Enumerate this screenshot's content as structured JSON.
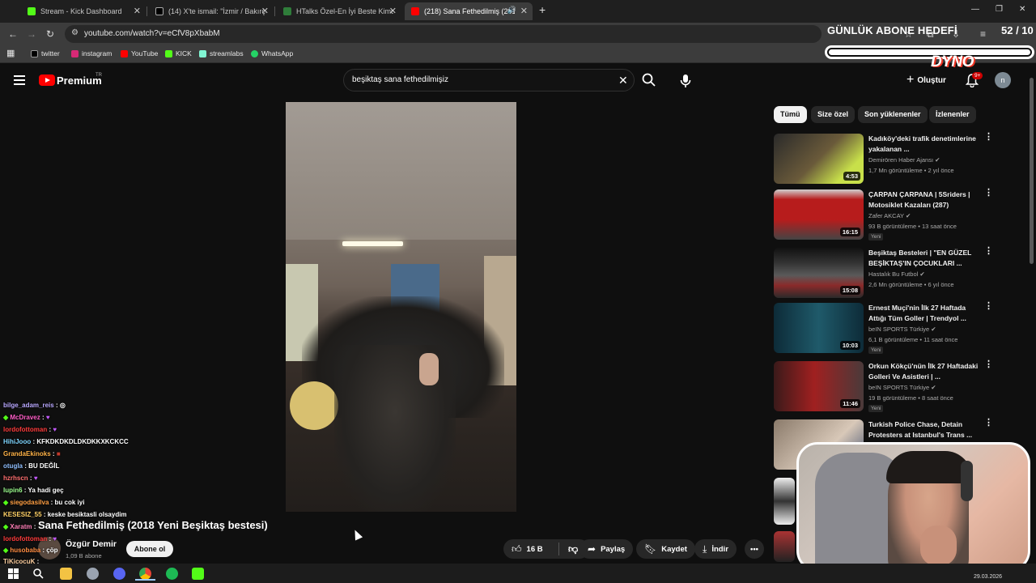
{
  "browser": {
    "tabs": [
      {
        "label": "Stream - Kick Dashboard",
        "color": "#53fc18"
      },
      {
        "label": "(14) X'te ismail: \"İzmir / Bakırçay\"",
        "color": "#000000"
      },
      {
        "label": "HTalks Özel-En İyi Beste Kimde",
        "color": "#2f7d3a"
      },
      {
        "label": "(218) Sana Fethedilmiş (2018",
        "color": "#ff0000"
      }
    ],
    "url": "youtube.com/watch?v=eCfV8pXbabM",
    "bookmarks": [
      {
        "label": "twitter",
        "color": "#000000"
      },
      {
        "label": "instagram",
        "color": "#d62976"
      },
      {
        "label": "YouTube",
        "color": "#ff0000"
      },
      {
        "label": "KICK",
        "color": "#53fc18"
      },
      {
        "label": "streamlabs",
        "color": "#80f5d2"
      },
      {
        "label": "WhatsApp",
        "color": "#25d366"
      }
    ]
  },
  "overlay": {
    "goal_title": "GÜNLÜK ABONE HEDEFİ",
    "goal_count": "52 / 10",
    "goal_progress": 1.0,
    "brand": "DYNO"
  },
  "youtube": {
    "logo_text": "Premium",
    "region": "TR",
    "search_value": "beşiktaş sana fethedilmişiz",
    "create_label": "Oluştur",
    "notif_badge": "9+",
    "avatar_letter": "n",
    "video": {
      "title": "Sana Fethedilmiş (2018 Yeni Beşiktaş bestesi)",
      "channel": "Özgür Demir",
      "subscribers": "1,09 B abone",
      "subscribe_label": "Abone ol",
      "likes": "16 B",
      "share_label": "Paylaş",
      "save_label": "Kaydet",
      "download_label": "İndir"
    },
    "chips": [
      "Tümü",
      "Size özel",
      "Son yüklenenler",
      "İzlenenler"
    ],
    "recommendations": [
      {
        "title": "Kadıköy'deki trafik denetimlerine yakalanan ...",
        "channel": "Demirören Haber Ajansı",
        "meta": "1,7 Mn görüntüleme • 2 yıl önce",
        "duration": "4:53",
        "badge": "",
        "thumb": "#4a3a2a"
      },
      {
        "title": "ÇARPAN ÇARPANA | 5Sriders | Motosiklet Kazaları (287)",
        "channel": "Zafer AKCAY",
        "meta": "93 B görüntüleme • 13 saat önce",
        "duration": "16:15",
        "badge": "Yeni",
        "thumb": "#c62828"
      },
      {
        "title": "Beşiktaş Besteleri | \"EN GÜZEL BEŞİKTAŞ'IN ÇOCUKLARI ...",
        "channel": "Hastalık Bu Futbol",
        "meta": "2,6 Mn görüntüleme • 6 yıl önce",
        "duration": "15:08",
        "badge": "",
        "thumb": "#3a3a3a"
      },
      {
        "title": "Ernest Muçi'nin İlk 27 Haftada Attığı Tüm Goller | Trendyol ...",
        "channel": "beIN SPORTS Türkiye",
        "meta": "6,1 B görüntüleme • 11 saat önce",
        "duration": "10:03",
        "badge": "Yeni",
        "thumb": "#1f4e5a"
      },
      {
        "title": "Orkun Kökçü'nün İlk 27 Haftadaki Golleri Ve Asistleri | ...",
        "channel": "beIN SPORTS Türkiye",
        "meta": "19 B görüntüleme • 8 saat önce",
        "duration": "11:46",
        "badge": "Yeni",
        "thumb": "#5a2a2a"
      },
      {
        "title": "Turkish Police Chase, Detain Protesters at Istanbul's Trans ...",
        "channel": "",
        "meta": "",
        "duration": "",
        "badge": "",
        "thumb": "#6a5a4a"
      }
    ]
  },
  "chat": [
    {
      "user": "bilge_adam_reis",
      "msg": ":",
      "color": "#b9a8ff"
    },
    {
      "user": "McDravez",
      "msg": ":",
      "color": "#ff5ec8"
    },
    {
      "user": "lordofottoman",
      "msg": ":",
      "color": "#ff3b3b"
    },
    {
      "user": "HihiJooo",
      "msg": ": KFKDKDKDLDKDKKXKCKCC",
      "color": "#7fd6ff"
    },
    {
      "user": "GrandaEkinoks",
      "msg": ":",
      "color": "#ffb347"
    },
    {
      "user": "otugla",
      "msg": ": BU DEĞİL",
      "color": "#8fbfff"
    },
    {
      "user": "hzrhscn",
      "msg": ":",
      "color": "#ff6f6f"
    },
    {
      "user": "lupin6",
      "msg": ": Ya hadi geç",
      "color": "#9cff8f"
    },
    {
      "user": "siegodasilva",
      "msg": ": bu cok iyi",
      "color": "#ff9f43"
    },
    {
      "user": "KESESIZ_55",
      "msg": ": keske besiktasli olsaydim",
      "color": "#ffd166"
    },
    {
      "user": "Xaratm",
      "msg": ":",
      "color": "#ff7eb6"
    },
    {
      "user": "lordofottoman",
      "msg": ":",
      "color": "#ff3b3b"
    },
    {
      "user": "husobaba",
      "msg": ": çöp",
      "color": "#ff8c42"
    },
    {
      "user": "TiKicocuK",
      "msg": ":",
      "color": "#ffd0a1"
    }
  ],
  "system": {
    "date": "29.03.2026"
  }
}
